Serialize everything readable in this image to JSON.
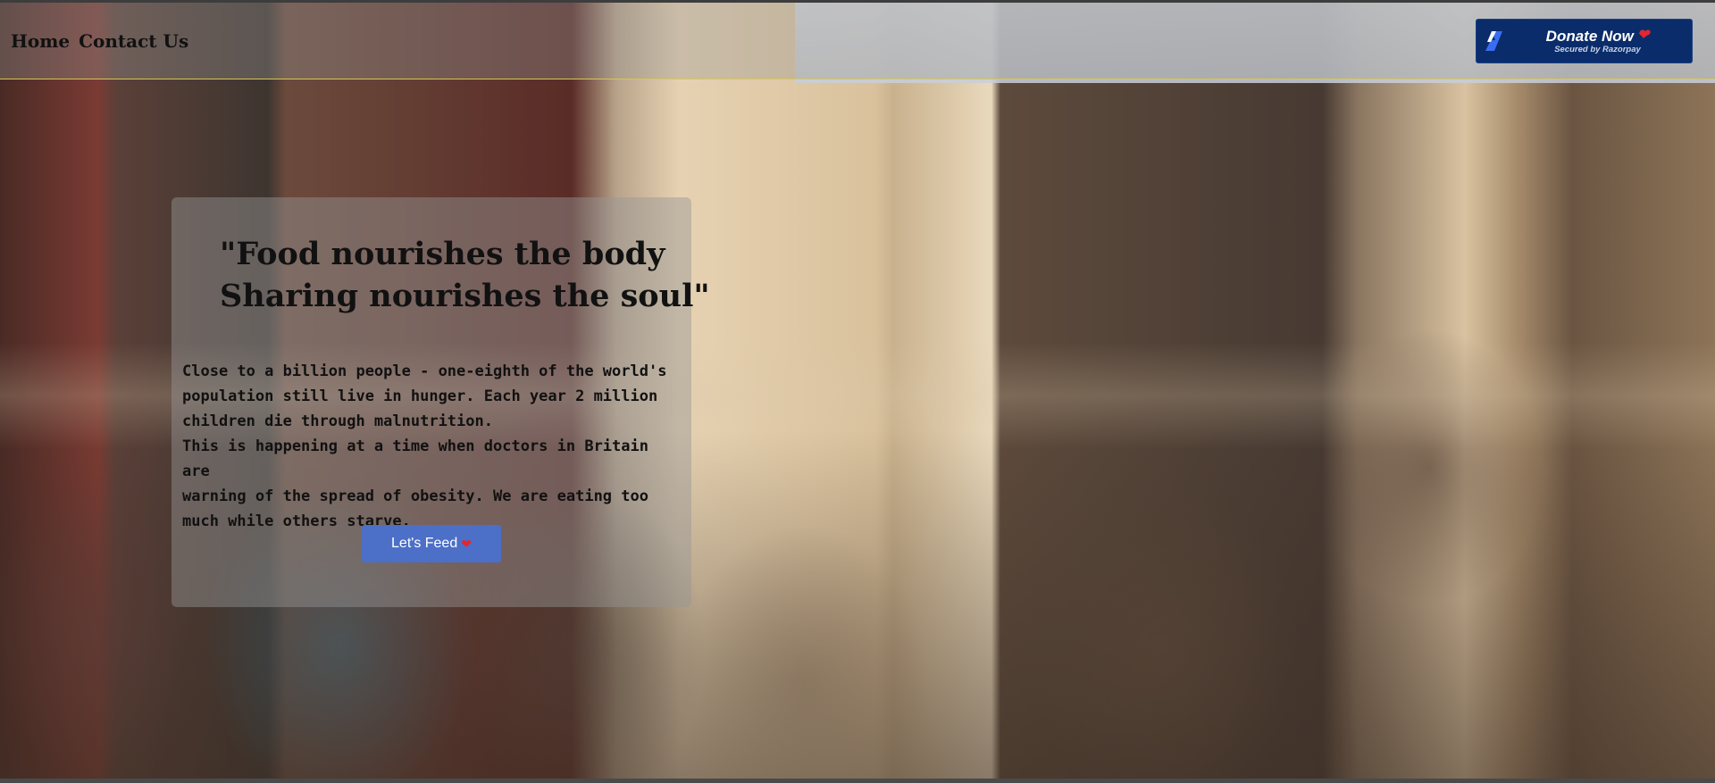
{
  "nav": {
    "links": [
      "Home",
      "Contact Us"
    ]
  },
  "donate_button": {
    "title": "Donate Now",
    "subtitle": "Secured by Razorpay",
    "logo_icon": "razorpay-logo-icon",
    "heart_icon": "heart-icon"
  },
  "hero": {
    "quote_lines": [
      "\"Food nourishes the body",
      "Sharing nourishes the soul\""
    ],
    "body_lines": [
      "Close to a billion people - one-eighth of the world's",
      "population still live in hunger. Each year 2 million",
      "children die through malnutrition.",
      "This is happening at a time when doctors in Britain are",
      "warning of the spread of obesity. We are eating too",
      "much while others starve."
    ],
    "cta_label": "Let's Feed",
    "background_image": "children-looking-up-photo"
  },
  "colors": {
    "donate_bg": "#0a2c6a",
    "cta_bg": "#4c6fc8",
    "heart": "#e3262f",
    "navbar_border": "#d9c74a"
  }
}
